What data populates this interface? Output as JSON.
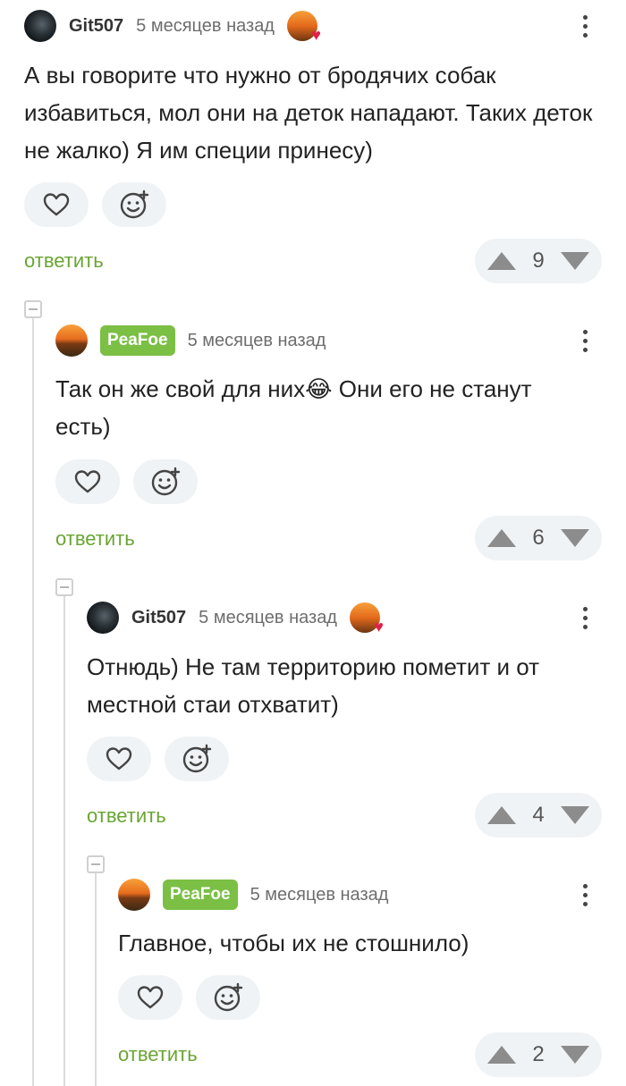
{
  "colors": {
    "accent": "#6aa533",
    "badge": "#7bbf45",
    "pill_bg": "#f0f3f5"
  },
  "comments": [
    {
      "user": "Git507",
      "time": "5 месяцев назад",
      "text": "А вы говорите что нужно от бродячих собак избавиться, мол они на деток нападают. Таких деток не жалко) Я им специи принесу)",
      "reply_label": "ответить",
      "score": "9"
    },
    {
      "user": "PeaFoe",
      "time": "5 месяцев назад",
      "text_before": "Так он же свой для них",
      "emoji": "😂",
      "text_after": " Они его не станут есть)",
      "reply_label": "ответить",
      "score": "6"
    },
    {
      "user": "Git507",
      "time": "5 месяцев назад",
      "text": "Отнюдь) Не там территорию пометит и от местной стаи отхватит)",
      "reply_label": "ответить",
      "score": "4"
    },
    {
      "user": "PeaFoe",
      "time": "5 месяцев назад",
      "text": "Главное, чтобы их не стошнило)",
      "reply_label": "ответить",
      "score": "2"
    }
  ]
}
